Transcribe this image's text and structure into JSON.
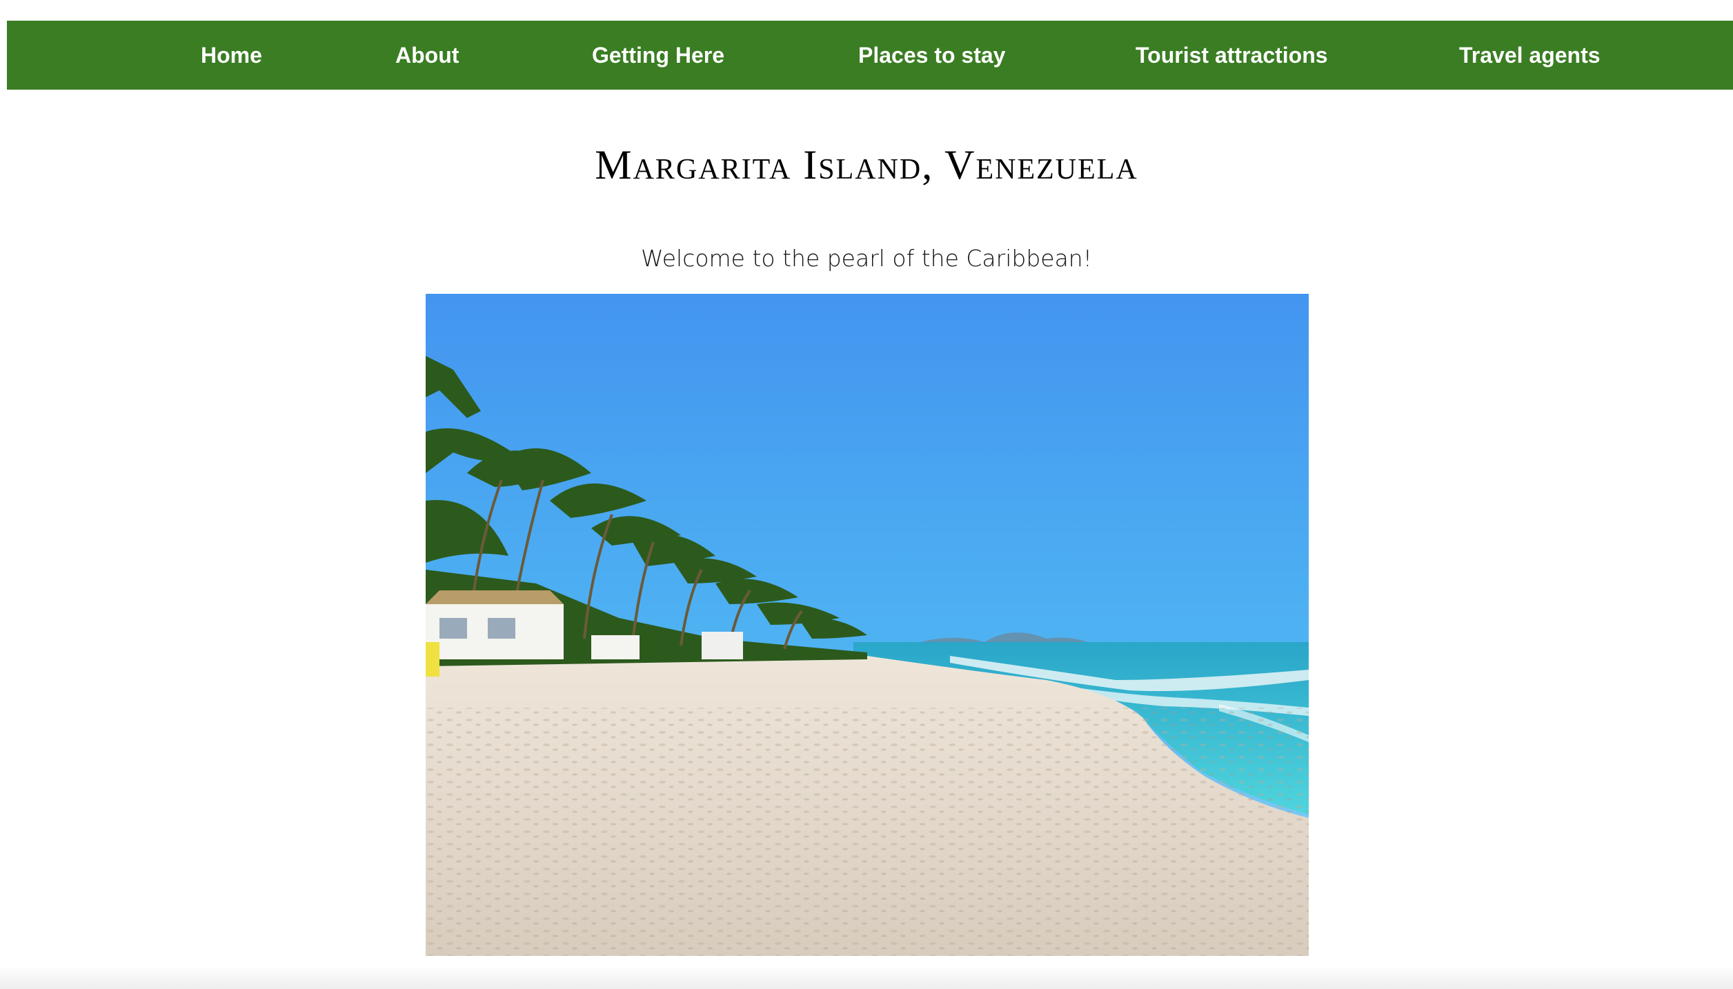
{
  "nav": {
    "background": "#3a7d23",
    "items": [
      {
        "label": "Home"
      },
      {
        "label": "About"
      },
      {
        "label": "Getting Here"
      },
      {
        "label": "Places to stay"
      },
      {
        "label": "Tourist attractions"
      },
      {
        "label": "Travel agents"
      }
    ]
  },
  "main": {
    "title": "Margarita Island, Venezuela",
    "subtitle": "Welcome to the pearl of the Caribbean!",
    "image": {
      "subject": "beach-photo",
      "colors": {
        "sky": "#4a9ff0",
        "sea": "#3cc7d6",
        "sand": "#e8ddd0",
        "palms": "#2f5a1f"
      }
    }
  }
}
